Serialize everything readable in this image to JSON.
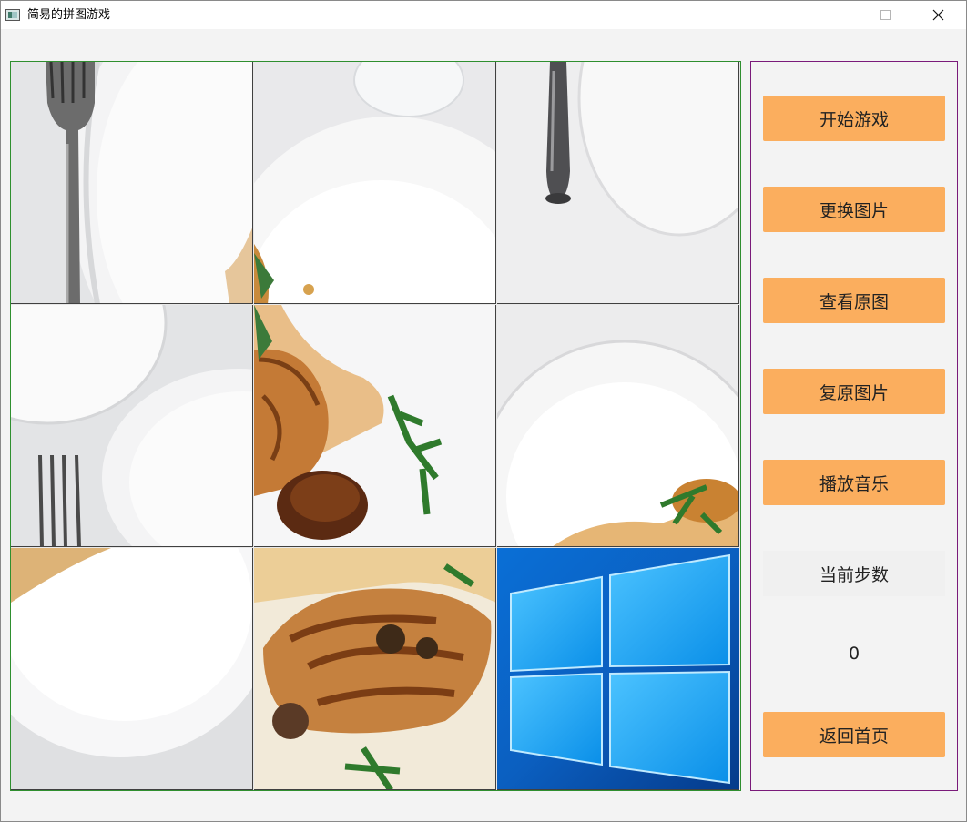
{
  "window": {
    "title": "简易的拼图游戏",
    "icons": {
      "app": "app-icon",
      "minimize": "minimize-icon",
      "maximize": "maximize-icon",
      "close": "close-icon"
    }
  },
  "board": {
    "rows": 3,
    "cols": 3,
    "tiles": [
      {
        "row": 1,
        "col": 1,
        "content": "plate-with-fork"
      },
      {
        "row": 1,
        "col": 2,
        "content": "plate-with-sauce"
      },
      {
        "row": 1,
        "col": 3,
        "content": "knife-handle"
      },
      {
        "row": 2,
        "col": 1,
        "content": "plates-and-fork"
      },
      {
        "row": 2,
        "col": 2,
        "content": "chicken-with-herb"
      },
      {
        "row": 2,
        "col": 3,
        "content": "plate-rim-with-herb"
      },
      {
        "row": 3,
        "col": 1,
        "content": "plate-edge"
      },
      {
        "row": 3,
        "col": 2,
        "content": "roasted-chicken"
      },
      {
        "row": 3,
        "col": 3,
        "content": "blank-tile-windows-logo"
      }
    ]
  },
  "sidebar": {
    "start_label": "开始游戏",
    "change_label": "更换图片",
    "view_label": "查看原图",
    "restore_label": "复原图片",
    "music_label": "播放音乐",
    "steps_label": "当前步数",
    "steps_value": "0",
    "back_label": "返回首页"
  },
  "colors": {
    "button_bg": "#fbae5e",
    "board_border": "#2f8f2f",
    "sidebar_border": "#7a1a7a",
    "window_bg": "#f3f3f3"
  }
}
